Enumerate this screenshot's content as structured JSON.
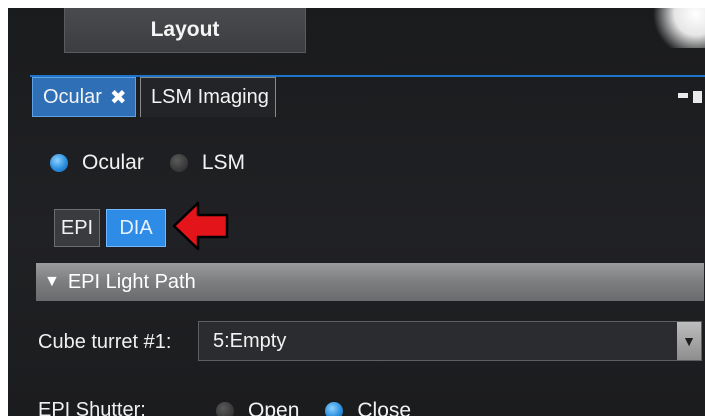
{
  "header": {
    "layout_label": "Layout"
  },
  "tabs": [
    {
      "label": "Ocular",
      "close": "✖"
    },
    {
      "label": "LSM Imaging"
    }
  ],
  "mode_radio": {
    "options": [
      {
        "label": "Ocular",
        "selected": true
      },
      {
        "label": "LSM",
        "selected": false
      }
    ]
  },
  "light_toggle": {
    "options": [
      {
        "label": "EPI",
        "selected": false
      },
      {
        "label": "DIA",
        "selected": true
      }
    ]
  },
  "section": {
    "triangle": "▼",
    "title": "EPI Light Path"
  },
  "cube_turret": {
    "label": "Cube turret #1:",
    "value": "5:Empty",
    "arrow": "▼"
  },
  "epi_shutter": {
    "label": "EPI Shutter:",
    "options": [
      {
        "label": "Open",
        "selected": false
      },
      {
        "label": "Close",
        "selected": true
      }
    ]
  },
  "colors": {
    "accent": "#2f8ce6",
    "annotation_arrow": "#e4141b"
  }
}
